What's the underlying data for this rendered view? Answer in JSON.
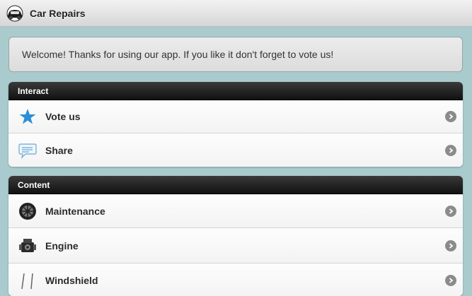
{
  "header": {
    "title": "Car Repairs",
    "icon": "car-icon"
  },
  "welcome": {
    "text": "Welcome! Thanks for using our app. If you like it don't forget to vote us!"
  },
  "groups": [
    {
      "title": "Interact",
      "items": [
        {
          "label": "Vote us",
          "icon": "star-icon"
        },
        {
          "label": "Share",
          "icon": "speech-bubble-icon"
        }
      ]
    },
    {
      "title": "Content",
      "items": [
        {
          "label": "Maintenance",
          "icon": "wheel-icon"
        },
        {
          "label": "Engine",
          "icon": "engine-icon"
        },
        {
          "label": "Windshield",
          "icon": "wiper-icon"
        }
      ]
    }
  ],
  "colors": {
    "accent": "#2a8fd6",
    "background": "#a9cbcd",
    "header": "#1a1a1a"
  }
}
